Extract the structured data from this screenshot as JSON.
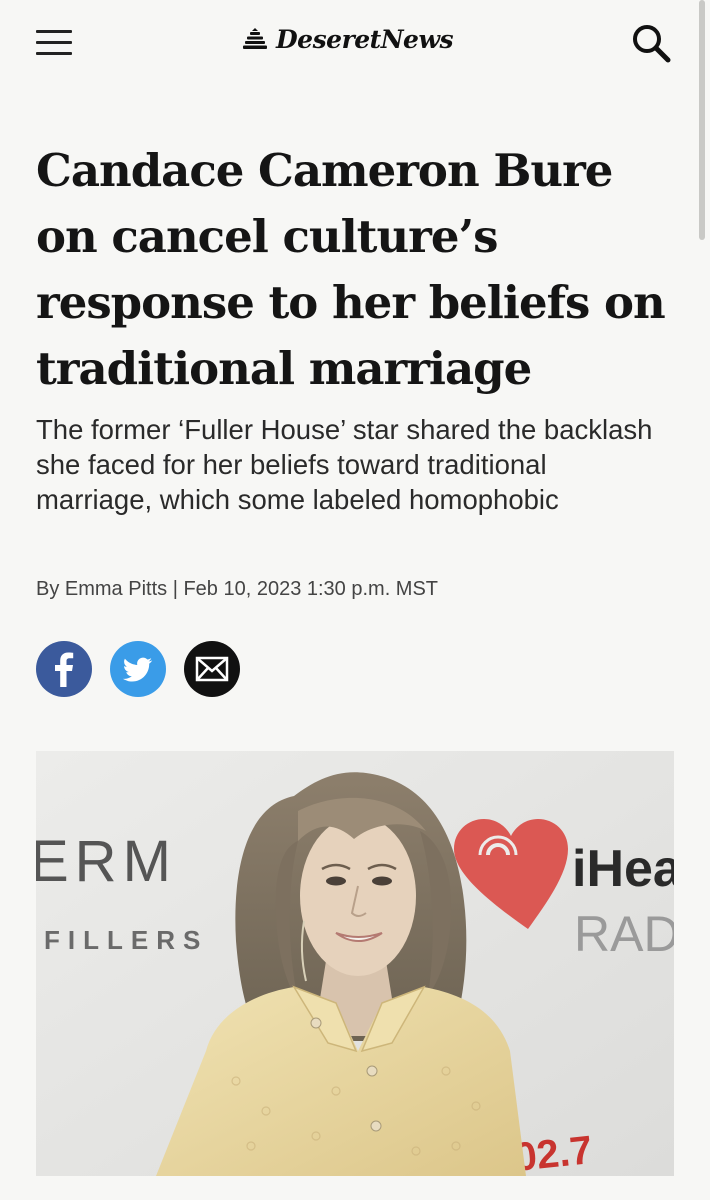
{
  "header": {
    "brand": "DeseretNews",
    "menu_icon": "hamburger-menu-icon",
    "search_icon": "search-icon",
    "logo_icon": "beehive-icon"
  },
  "article": {
    "headline": "Candace Cameron Bure on cancel culture’s response to her beliefs on traditional marriage",
    "dek": "The former ‘Fuller House’ star shared the backlash she faced for her beliefs toward traditional marriage, which some labeled homophobic",
    "byline": "By Emma Pitts | Feb 10, 2023 1:30 p.m. MST"
  },
  "share": [
    {
      "name": "facebook",
      "icon": "facebook-icon",
      "color": "#3b5a9c"
    },
    {
      "name": "twitter",
      "icon": "twitter-icon",
      "color": "#3a9ce8"
    },
    {
      "name": "email",
      "icon": "email-icon",
      "color": "#111111"
    }
  ],
  "photo": {
    "backdrop_text_left_1": "ERM",
    "backdrop_text_left_2": "FILLERS",
    "backdrop_text_right_1": "iHea",
    "backdrop_text_right_2": "RAD",
    "backdrop_text_bottom": "02.7"
  },
  "colors": {
    "background": "#f7f7f5",
    "text": "#151515",
    "iheart_red": "#c8342f"
  }
}
